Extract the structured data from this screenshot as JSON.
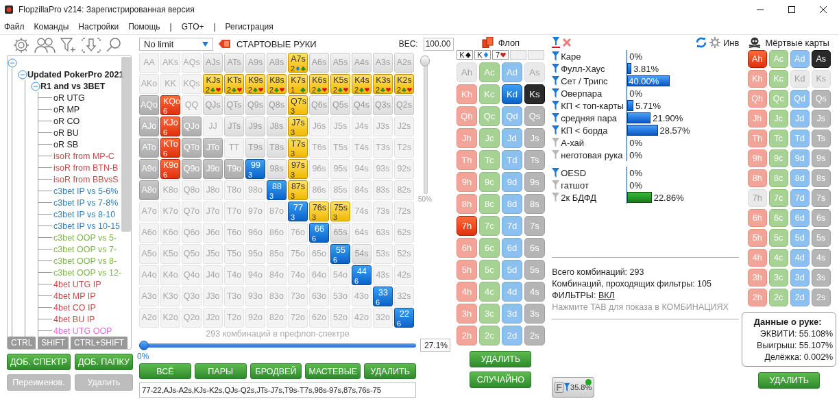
{
  "window": {
    "title": "FlopzillaPro v214: Зарегистрированная версия"
  },
  "menu": [
    "Файл",
    "Команды",
    "Настройки",
    "Помощь",
    "|",
    "GTO+",
    "|",
    "Регистрация"
  ],
  "tree": {
    "expanded": true,
    "children": [
      {
        "label": "Updated PokerPro 2021",
        "expanded": true,
        "children": [
          {
            "label": "R1 and vs 3BET",
            "expanded": true,
            "children": [
              {
                "label": "oR UTG",
                "color": "#1a1a1a"
              },
              {
                "label": "oR MP",
                "color": "#1a1a1a"
              },
              {
                "label": "oR CO",
                "color": "#1a1a1a"
              },
              {
                "label": "oR BU",
                "color": "#1a1a1a"
              },
              {
                "label": "oR SB",
                "color": "#1a1a1a"
              },
              {
                "label": "isoR from MP-C",
                "color": "#c94a4a"
              },
              {
                "label": "isoR from BTN-B",
                "color": "#c94a4a"
              },
              {
                "label": "isoR from BBvsS",
                "color": "#c94a4a"
              },
              {
                "label": "c3bet IP vs 5-6%",
                "color": "#2f7fb8"
              },
              {
                "label": "c3bet IP vs 7-8%",
                "color": "#2f7fb8"
              },
              {
                "label": "c3bet IP vs 8-10",
                "color": "#2f7fb8"
              },
              {
                "label": "c3bet IP vs 10-15",
                "color": "#2f7fb8"
              },
              {
                "label": "c3bet OOP vs 5-",
                "color": "#7ab648"
              },
              {
                "label": "c3bet OOP vs 7-",
                "color": "#7ab648"
              },
              {
                "label": "c3bet OOP vs 8-",
                "color": "#7ab648"
              },
              {
                "label": "c3bet OOP vs 12-",
                "color": "#7ab648"
              },
              {
                "label": "4bet UTG IP",
                "color": "#c94a4a"
              },
              {
                "label": "4bet MP IP",
                "color": "#c94a4a"
              },
              {
                "label": "4bet CO IP",
                "color": "#c94a4a"
              },
              {
                "label": "4bet BU IP",
                "color": "#c94a4a"
              },
              {
                "label": "4bet UTG OOP",
                "color": "#e070e0"
              }
            ]
          }
        ]
      }
    ]
  },
  "modifier_keys": [
    "CTRL",
    "SHIFT",
    "CTRL+SHIFT"
  ],
  "range_buttons": [
    {
      "label": "ДОБ. СПЕКТР",
      "disabled": false
    },
    {
      "label": "ДОБ. ПАПКУ",
      "disabled": false
    },
    {
      "label": "Переименов.",
      "disabled": true
    },
    {
      "label": "Удалить",
      "disabled": true
    }
  ],
  "grid_header": {
    "game": "No limit",
    "title": "СТАРТОВЫЕ РУКИ",
    "weight_label": "ВЕС:",
    "weight_value": "100.00"
  },
  "hand_grid": [
    [
      {
        "hand": "AA",
        "kind": "faded"
      },
      {
        "hand": "AKs",
        "kind": "faded"
      },
      {
        "hand": "AQs",
        "kind": "faded"
      },
      {
        "hand": "AJs",
        "kind": "normal"
      },
      {
        "hand": "ATs",
        "kind": "normal"
      },
      {
        "hand": "A9s",
        "kind": "normal"
      },
      {
        "hand": "A8s",
        "kind": "normal"
      },
      {
        "hand": "A7s",
        "kind": "yellow",
        "count": "2",
        "suits": [
          {
            "kind": "diamond"
          },
          {
            "kind": "club"
          }
        ]
      },
      {
        "hand": "A6s",
        "kind": "normal"
      },
      {
        "hand": "A5s",
        "kind": "normal"
      },
      {
        "hand": "A4s",
        "kind": "normal"
      },
      {
        "hand": "A3s",
        "kind": "normal"
      },
      {
        "hand": "A2s",
        "kind": "normal"
      }
    ],
    [
      {
        "hand": "AKo",
        "kind": "faded"
      },
      {
        "hand": "KK",
        "kind": "faded"
      },
      {
        "hand": "KQs",
        "kind": "faded"
      },
      {
        "hand": "KJs",
        "kind": "yellow",
        "count": "2",
        "suits": [
          {
            "kind": "club"
          },
          {
            "kind": "heart"
          }
        ]
      },
      {
        "hand": "KTs",
        "kind": "yellow",
        "count": "2",
        "suits": [
          {
            "kind": "club"
          },
          {
            "kind": "heart"
          }
        ]
      },
      {
        "hand": "K9s",
        "kind": "yellow",
        "count": "2",
        "suits": [
          {
            "kind": "club"
          },
          {
            "kind": "heart"
          }
        ]
      },
      {
        "hand": "K8s",
        "kind": "yellow",
        "count": "2",
        "suits": [
          {
            "kind": "club"
          },
          {
            "kind": "heart"
          }
        ]
      },
      {
        "hand": "K7s",
        "kind": "yellow",
        "count": "1",
        "suits": [
          {
            "kind": "club"
          }
        ]
      },
      {
        "hand": "K6s",
        "kind": "yellow",
        "count": "2",
        "suits": [
          {
            "kind": "club"
          },
          {
            "kind": "heart"
          }
        ]
      },
      {
        "hand": "K5s",
        "kind": "yellow",
        "count": "2",
        "suits": [
          {
            "kind": "club"
          },
          {
            "kind": "heart"
          }
        ]
      },
      {
        "hand": "K4s",
        "kind": "yellow",
        "count": "2",
        "suits": [
          {
            "kind": "club"
          },
          {
            "kind": "heart"
          }
        ]
      },
      {
        "hand": "K3s",
        "kind": "yellow",
        "count": "2",
        "suits": [
          {
            "kind": "club"
          },
          {
            "kind": "heart"
          }
        ]
      },
      {
        "hand": "K2s",
        "kind": "yellow",
        "count": "2",
        "suits": [
          {
            "kind": "club"
          },
          {
            "kind": "heart"
          }
        ]
      }
    ],
    [
      {
        "hand": "AQo",
        "kind": "grey"
      },
      {
        "hand": "KQo",
        "kind": "red",
        "count": "6"
      },
      {
        "hand": "QQ",
        "kind": "faded"
      },
      {
        "hand": "QJs",
        "kind": "normal"
      },
      {
        "hand": "QTs",
        "kind": "normal"
      },
      {
        "hand": "Q9s",
        "kind": "normal"
      },
      {
        "hand": "Q8s",
        "kind": "normal"
      },
      {
        "hand": "Q7s",
        "kind": "yellow",
        "count": "3"
      },
      {
        "hand": "Q6s",
        "kind": "normal"
      },
      {
        "hand": "Q5s",
        "kind": "normal"
      },
      {
        "hand": "Q4s",
        "kind": "normal"
      },
      {
        "hand": "Q3s",
        "kind": "normal"
      },
      {
        "hand": "Q2s",
        "kind": "normal"
      }
    ],
    [
      {
        "hand": "AJo",
        "kind": "grey"
      },
      {
        "hand": "KJo",
        "kind": "red",
        "count": "6"
      },
      {
        "hand": "QJo",
        "kind": "grey"
      },
      {
        "hand": "JJ",
        "kind": "faded"
      },
      {
        "hand": "JTs",
        "kind": "normal"
      },
      {
        "hand": "J9s",
        "kind": "normal"
      },
      {
        "hand": "J8s",
        "kind": "normal"
      },
      {
        "hand": "J7s",
        "kind": "yellow",
        "count": "3"
      },
      {
        "hand": "J6s",
        "kind": "faded"
      },
      {
        "hand": "J5s",
        "kind": "faded"
      },
      {
        "hand": "J4s",
        "kind": "faded"
      },
      {
        "hand": "J3s",
        "kind": "faded"
      },
      {
        "hand": "J2s",
        "kind": "faded"
      }
    ],
    [
      {
        "hand": "ATo",
        "kind": "grey"
      },
      {
        "hand": "KTo",
        "kind": "red",
        "count": "6"
      },
      {
        "hand": "QTo",
        "kind": "grey"
      },
      {
        "hand": "JTo",
        "kind": "grey"
      },
      {
        "hand": "TT",
        "kind": "faded"
      },
      {
        "hand": "T9s",
        "kind": "normal"
      },
      {
        "hand": "T8s",
        "kind": "normal"
      },
      {
        "hand": "T7s",
        "kind": "yellow",
        "count": "3"
      },
      {
        "hand": "T6s",
        "kind": "faded"
      },
      {
        "hand": "T5s",
        "kind": "faded"
      },
      {
        "hand": "T4s",
        "kind": "faded"
      },
      {
        "hand": "T3s",
        "kind": "faded"
      },
      {
        "hand": "T2s",
        "kind": "faded"
      }
    ],
    [
      {
        "hand": "A9o",
        "kind": "grey"
      },
      {
        "hand": "K9o",
        "kind": "red",
        "count": "6"
      },
      {
        "hand": "Q9o",
        "kind": "grey"
      },
      {
        "hand": "J9o",
        "kind": "grey"
      },
      {
        "hand": "T9o",
        "kind": "grey"
      },
      {
        "hand": "99",
        "kind": "blue",
        "count": "3"
      },
      {
        "hand": "98s",
        "kind": "normal"
      },
      {
        "hand": "97s",
        "kind": "yellow",
        "count": "3"
      },
      {
        "hand": "96s",
        "kind": "faded"
      },
      {
        "hand": "95s",
        "kind": "faded"
      },
      {
        "hand": "94s",
        "kind": "faded"
      },
      {
        "hand": "93s",
        "kind": "faded"
      },
      {
        "hand": "92s",
        "kind": "faded"
      }
    ],
    [
      {
        "hand": "A8o",
        "kind": "grey"
      },
      {
        "hand": "K8o",
        "kind": "faded"
      },
      {
        "hand": "Q8o",
        "kind": "faded"
      },
      {
        "hand": "J8o",
        "kind": "faded"
      },
      {
        "hand": "T8o",
        "kind": "faded"
      },
      {
        "hand": "98o",
        "kind": "faded"
      },
      {
        "hand": "88",
        "kind": "blue",
        "count": "3"
      },
      {
        "hand": "87s",
        "kind": "yellow",
        "count": "3"
      },
      {
        "hand": "86s",
        "kind": "faded"
      },
      {
        "hand": "85s",
        "kind": "faded"
      },
      {
        "hand": "84s",
        "kind": "faded"
      },
      {
        "hand": "83s",
        "kind": "faded"
      },
      {
        "hand": "82s",
        "kind": "faded"
      }
    ],
    [
      {
        "hand": "A7o",
        "kind": "faded"
      },
      {
        "hand": "K7o",
        "kind": "faded"
      },
      {
        "hand": "Q7o",
        "kind": "faded"
      },
      {
        "hand": "J7o",
        "kind": "faded"
      },
      {
        "hand": "T7o",
        "kind": "faded"
      },
      {
        "hand": "97o",
        "kind": "faded"
      },
      {
        "hand": "87o",
        "kind": "faded"
      },
      {
        "hand": "77",
        "kind": "blue",
        "count": "3"
      },
      {
        "hand": "76s",
        "kind": "yellow",
        "count": "3"
      },
      {
        "hand": "75s",
        "kind": "yellow",
        "count": "3"
      },
      {
        "hand": "74s",
        "kind": "faded"
      },
      {
        "hand": "73s",
        "kind": "faded"
      },
      {
        "hand": "72s",
        "kind": "faded"
      }
    ],
    [
      {
        "hand": "A6o",
        "kind": "faded"
      },
      {
        "hand": "K6o",
        "kind": "faded"
      },
      {
        "hand": "Q6o",
        "kind": "faded"
      },
      {
        "hand": "J6o",
        "kind": "faded"
      },
      {
        "hand": "T6o",
        "kind": "faded"
      },
      {
        "hand": "96o",
        "kind": "faded"
      },
      {
        "hand": "86o",
        "kind": "faded"
      },
      {
        "hand": "76o",
        "kind": "faded"
      },
      {
        "hand": "66",
        "kind": "blue",
        "count": "6"
      },
      {
        "hand": "65s",
        "kind": "normal"
      },
      {
        "hand": "64s",
        "kind": "faded"
      },
      {
        "hand": "63s",
        "kind": "faded"
      },
      {
        "hand": "62s",
        "kind": "faded"
      }
    ],
    [
      {
        "hand": "A5o",
        "kind": "faded"
      },
      {
        "hand": "K5o",
        "kind": "faded"
      },
      {
        "hand": "Q5o",
        "kind": "faded"
      },
      {
        "hand": "J5o",
        "kind": "faded"
      },
      {
        "hand": "T5o",
        "kind": "faded"
      },
      {
        "hand": "95o",
        "kind": "faded"
      },
      {
        "hand": "85o",
        "kind": "faded"
      },
      {
        "hand": "75o",
        "kind": "faded"
      },
      {
        "hand": "65o",
        "kind": "faded"
      },
      {
        "hand": "55",
        "kind": "blue",
        "count": "6"
      },
      {
        "hand": "54s",
        "kind": "normal"
      },
      {
        "hand": "53s",
        "kind": "faded"
      },
      {
        "hand": "52s",
        "kind": "faded"
      }
    ],
    [
      {
        "hand": "A4o",
        "kind": "faded"
      },
      {
        "hand": "K4o",
        "kind": "faded"
      },
      {
        "hand": "Q4o",
        "kind": "faded"
      },
      {
        "hand": "J4o",
        "kind": "faded"
      },
      {
        "hand": "T4o",
        "kind": "faded"
      },
      {
        "hand": "94o",
        "kind": "faded"
      },
      {
        "hand": "84o",
        "kind": "faded"
      },
      {
        "hand": "74o",
        "kind": "faded"
      },
      {
        "hand": "64o",
        "kind": "faded"
      },
      {
        "hand": "54o",
        "kind": "faded"
      },
      {
        "hand": "44",
        "kind": "blue",
        "count": "6"
      },
      {
        "hand": "43s",
        "kind": "faded"
      },
      {
        "hand": "42s",
        "kind": "faded"
      }
    ],
    [
      {
        "hand": "A3o",
        "kind": "faded"
      },
      {
        "hand": "K3o",
        "kind": "faded"
      },
      {
        "hand": "Q3o",
        "kind": "faded"
      },
      {
        "hand": "J3o",
        "kind": "faded"
      },
      {
        "hand": "T3o",
        "kind": "faded"
      },
      {
        "hand": "93o",
        "kind": "faded"
      },
      {
        "hand": "83o",
        "kind": "faded"
      },
      {
        "hand": "73o",
        "kind": "faded"
      },
      {
        "hand": "63o",
        "kind": "faded"
      },
      {
        "hand": "53o",
        "kind": "faded"
      },
      {
        "hand": "43o",
        "kind": "faded"
      },
      {
        "hand": "33",
        "kind": "blue",
        "count": "6"
      },
      {
        "hand": "32s",
        "kind": "faded"
      }
    ],
    [
      {
        "hand": "A2o",
        "kind": "faded"
      },
      {
        "hand": "K2o",
        "kind": "faded"
      },
      {
        "hand": "Q2o",
        "kind": "faded"
      },
      {
        "hand": "J2o",
        "kind": "faded"
      },
      {
        "hand": "T2o",
        "kind": "faded"
      },
      {
        "hand": "92o",
        "kind": "faded"
      },
      {
        "hand": "82o",
        "kind": "faded"
      },
      {
        "hand": "72o",
        "kind": "faded"
      },
      {
        "hand": "62o",
        "kind": "faded"
      },
      {
        "hand": "52o",
        "kind": "faded"
      },
      {
        "hand": "42o",
        "kind": "faded"
      },
      {
        "hand": "32o",
        "kind": "faded"
      },
      {
        "hand": "22",
        "kind": "blue",
        "count": "6"
      }
    ]
  ],
  "weight_slider": {
    "level": 1,
    "tick_label": "50%"
  },
  "range_info": {
    "caption": "293 комбинаций в префлоп-спектре",
    "level": 0,
    "min_label": "0%",
    "percent": "27.1%"
  },
  "grid_buttons": [
    "ВСЁ",
    "ПАРЫ",
    "БРОДВЕЙ",
    "МАСТЕВЫЕ",
    "УДАЛИТЬ"
  ],
  "range_text": "77-22,AJs-A2s,KJs-K2s,QJs-Q2s,JTs-J7s,T9s-T7s,98s-97s,87s,76s-75",
  "flop": {
    "title": "Флоп",
    "board": [
      {
        "kind": "card",
        "rank": "K",
        "suit": {
          "kind": "spade"
        }
      },
      {
        "kind": "card",
        "rank": "K",
        "suit": {
          "kind": "diamond"
        }
      },
      {
        "kind": "card",
        "rank": "7",
        "suit": {
          "kind": "heart"
        }
      },
      {
        "kind": "empty"
      },
      {
        "kind": "empty"
      }
    ],
    "deck": [
      [
        {
          "card": "Ah",
          "kind": "heart",
          "selected": false,
          "disabled": true
        },
        {
          "card": "Ac",
          "kind": "club",
          "selected": false,
          "disabled": false
        },
        {
          "card": "Ad",
          "kind": "diamond",
          "selected": false,
          "disabled": false
        },
        {
          "card": "As",
          "kind": "spade",
          "selected": false,
          "disabled": true
        }
      ],
      [
        {
          "card": "Kh",
          "kind": "heart",
          "selected": false,
          "disabled": false
        },
        {
          "card": "Kc",
          "kind": "club",
          "selected": false,
          "disabled": false
        },
        {
          "card": "Kd",
          "kind": "diamond",
          "selected": true,
          "disabled": false
        },
        {
          "card": "Ks",
          "kind": "spade",
          "selected": true,
          "disabled": false
        }
      ],
      [
        {
          "card": "Qh",
          "kind": "heart",
          "selected": false,
          "disabled": false
        },
        {
          "card": "Qc",
          "kind": "club",
          "selected": false,
          "disabled": false
        },
        {
          "card": "Qd",
          "kind": "diamond",
          "selected": false,
          "disabled": false
        },
        {
          "card": "Qs",
          "kind": "spade",
          "selected": false,
          "disabled": false
        }
      ],
      [
        {
          "card": "Jh",
          "kind": "heart",
          "selected": false,
          "disabled": false
        },
        {
          "card": "Jc",
          "kind": "club",
          "selected": false,
          "disabled": false
        },
        {
          "card": "Jd",
          "kind": "diamond",
          "selected": false,
          "disabled": false
        },
        {
          "card": "Js",
          "kind": "spade",
          "selected": false,
          "disabled": false
        }
      ],
      [
        {
          "card": "Th",
          "kind": "heart",
          "selected": false,
          "disabled": false
        },
        {
          "card": "Tc",
          "kind": "club",
          "selected": false,
          "disabled": false
        },
        {
          "card": "Td",
          "kind": "diamond",
          "selected": false,
          "disabled": false
        },
        {
          "card": "Ts",
          "kind": "spade",
          "selected": false,
          "disabled": false
        }
      ],
      [
        {
          "card": "9h",
          "kind": "heart",
          "selected": false,
          "disabled": false
        },
        {
          "card": "9c",
          "kind": "club",
          "selected": false,
          "disabled": false
        },
        {
          "card": "9d",
          "kind": "diamond",
          "selected": false,
          "disabled": false
        },
        {
          "card": "9s",
          "kind": "spade",
          "selected": false,
          "disabled": false
        }
      ],
      [
        {
          "card": "8h",
          "kind": "heart",
          "selected": false,
          "disabled": false
        },
        {
          "card": "8c",
          "kind": "club",
          "selected": false,
          "disabled": false
        },
        {
          "card": "8d",
          "kind": "diamond",
          "selected": false,
          "disabled": false
        },
        {
          "card": "8s",
          "kind": "spade",
          "selected": false,
          "disabled": false
        }
      ],
      [
        {
          "card": "7h",
          "kind": "heart",
          "selected": true,
          "disabled": false
        },
        {
          "card": "7c",
          "kind": "club",
          "selected": false,
          "disabled": false
        },
        {
          "card": "7d",
          "kind": "diamond",
          "selected": false,
          "disabled": false
        },
        {
          "card": "7s",
          "kind": "spade",
          "selected": false,
          "disabled": false
        }
      ],
      [
        {
          "card": "6h",
          "kind": "heart",
          "selected": false,
          "disabled": false
        },
        {
          "card": "6c",
          "kind": "club",
          "selected": false,
          "disabled": false
        },
        {
          "card": "6d",
          "kind": "diamond",
          "selected": false,
          "disabled": false
        },
        {
          "card": "6s",
          "kind": "spade",
          "selected": false,
          "disabled": false
        }
      ],
      [
        {
          "card": "5h",
          "kind": "heart",
          "selected": false,
          "disabled": false
        },
        {
          "card": "5c",
          "kind": "club",
          "selected": false,
          "disabled": false
        },
        {
          "card": "5d",
          "kind": "diamond",
          "selected": false,
          "disabled": false
        },
        {
          "card": "5s",
          "kind": "spade",
          "selected": false,
          "disabled": false
        }
      ],
      [
        {
          "card": "4h",
          "kind": "heart",
          "selected": false,
          "disabled": false
        },
        {
          "card": "4c",
          "kind": "club",
          "selected": false,
          "disabled": false
        },
        {
          "card": "4d",
          "kind": "diamond",
          "selected": false,
          "disabled": false
        },
        {
          "card": "4s",
          "kind": "spade",
          "selected": false,
          "disabled": false
        }
      ],
      [
        {
          "card": "3h",
          "kind": "heart",
          "selected": false,
          "disabled": false
        },
        {
          "card": "3c",
          "kind": "club",
          "selected": false,
          "disabled": false
        },
        {
          "card": "3d",
          "kind": "diamond",
          "selected": false,
          "disabled": false
        },
        {
          "card": "3s",
          "kind": "spade",
          "selected": false,
          "disabled": false
        }
      ],
      [
        {
          "card": "2h",
          "kind": "heart",
          "selected": false,
          "disabled": false
        },
        {
          "card": "2c",
          "kind": "club",
          "selected": false,
          "disabled": false
        },
        {
          "card": "2d",
          "kind": "diamond",
          "selected": false,
          "disabled": false
        },
        {
          "card": "2s",
          "kind": "spade",
          "selected": false,
          "disabled": false
        }
      ]
    ],
    "buttons": [
      "УДАЛИТЬ",
      "СЛУЧАЙНО"
    ]
  },
  "stats": {
    "invert_label": "Инв",
    "groups": [
      {
        "kind": "made",
        "rows": [
          {
            "label": "Каре",
            "active": true,
            "level": 0,
            "value": "0%",
            "selected": false
          },
          {
            "label": "Фулл-Хаус",
            "active": true,
            "level": 0.0381,
            "value": "3.81%",
            "selected": false
          },
          {
            "label": "Сет / Трипс",
            "active": true,
            "level": 0.4,
            "value": "40.00%",
            "selected": true
          },
          {
            "label": "Оверпара",
            "active": true,
            "level": 0,
            "value": "0%",
            "selected": false
          },
          {
            "label": "КП < топ-карты",
            "active": true,
            "level": 0.0571,
            "value": "5.71%",
            "selected": false
          },
          {
            "label": "средняя пара",
            "active": true,
            "level": 0.219,
            "value": "21.90%",
            "selected": false
          },
          {
            "label": "КП < борда",
            "active": true,
            "level": 0.2857,
            "value": "28.57%",
            "selected": false
          },
          {
            "label": "А-хай",
            "active": false,
            "level": 0,
            "value": "0%",
            "selected": false
          },
          {
            "label": "неготовая рука",
            "active": false,
            "level": 0,
            "value": "0%",
            "selected": false
          }
        ]
      },
      {
        "kind": "draw",
        "rows": [
          {
            "label": "OESD",
            "active": true,
            "level": 0,
            "value": "0%",
            "selected": false
          },
          {
            "label": "гатшот",
            "active": false,
            "level": 0,
            "value": "0%",
            "selected": false
          },
          {
            "label": "2к БДФД",
            "active": false,
            "level": 0.2286,
            "value": "22.86%",
            "selected": false
          }
        ]
      }
    ],
    "total": "Всего комбинаций: 293",
    "passing": "Комбинаций, проходящих фильтры: 105",
    "filters": {
      "label": "ФИЛЬТРЫ:",
      "link": "ВКЛ"
    },
    "hint": "Нажмите TAB для показа в КОМБИНАЦИЯХ",
    "filter_button": {
      "letter": "F",
      "value": "35.8%",
      "active": true
    }
  },
  "dead_cards": {
    "title": "Мёртвые карты",
    "deck": [
      [
        {
          "card": "Ah",
          "kind": "heart",
          "selected": true,
          "disabled": false
        },
        {
          "card": "Ac",
          "kind": "club",
          "selected": false,
          "disabled": false
        },
        {
          "card": "Ad",
          "kind": "diamond",
          "selected": false,
          "disabled": false
        },
        {
          "card": "As",
          "kind": "spade",
          "selected": true,
          "disabled": false
        }
      ],
      [
        {
          "card": "Kh",
          "kind": "heart",
          "selected": false,
          "disabled": false
        },
        {
          "card": "Kc",
          "kind": "club",
          "selected": false,
          "disabled": false
        },
        {
          "card": "Kd",
          "kind": "diamond",
          "selected": false,
          "disabled": true
        },
        {
          "card": "Ks",
          "kind": "spade",
          "selected": false,
          "disabled": true
        }
      ],
      [
        {
          "card": "Qh",
          "kind": "heart",
          "selected": false,
          "disabled": false
        },
        {
          "card": "Qc",
          "kind": "club",
          "selected": false,
          "disabled": false
        },
        {
          "card": "Qd",
          "kind": "diamond",
          "selected": false,
          "disabled": false
        },
        {
          "card": "Qs",
          "kind": "spade",
          "selected": false,
          "disabled": false
        }
      ],
      [
        {
          "card": "Jh",
          "kind": "heart",
          "selected": false,
          "disabled": false
        },
        {
          "card": "Jc",
          "kind": "club",
          "selected": false,
          "disabled": false
        },
        {
          "card": "Jd",
          "kind": "diamond",
          "selected": false,
          "disabled": false
        },
        {
          "card": "Js",
          "kind": "spade",
          "selected": false,
          "disabled": false
        }
      ],
      [
        {
          "card": "Th",
          "kind": "heart",
          "selected": false,
          "disabled": false
        },
        {
          "card": "Tc",
          "kind": "club",
          "selected": false,
          "disabled": false
        },
        {
          "card": "Td",
          "kind": "diamond",
          "selected": false,
          "disabled": false
        },
        {
          "card": "Ts",
          "kind": "spade",
          "selected": false,
          "disabled": false
        }
      ],
      [
        {
          "card": "9h",
          "kind": "heart",
          "selected": false,
          "disabled": false
        },
        {
          "card": "9c",
          "kind": "club",
          "selected": false,
          "disabled": false
        },
        {
          "card": "9d",
          "kind": "diamond",
          "selected": false,
          "disabled": false
        },
        {
          "card": "9s",
          "kind": "spade",
          "selected": false,
          "disabled": false
        }
      ],
      [
        {
          "card": "8h",
          "kind": "heart",
          "selected": false,
          "disabled": false
        },
        {
          "card": "8c",
          "kind": "club",
          "selected": false,
          "disabled": false
        },
        {
          "card": "8d",
          "kind": "diamond",
          "selected": false,
          "disabled": false
        },
        {
          "card": "8s",
          "kind": "spade",
          "selected": false,
          "disabled": false
        }
      ],
      [
        {
          "card": "7h",
          "kind": "heart",
          "selected": false,
          "disabled": true
        },
        {
          "card": "7c",
          "kind": "club",
          "selected": false,
          "disabled": false
        },
        {
          "card": "7d",
          "kind": "diamond",
          "selected": false,
          "disabled": false
        },
        {
          "card": "7s",
          "kind": "spade",
          "selected": false,
          "disabled": false
        }
      ],
      [
        {
          "card": "6h",
          "kind": "heart",
          "selected": false,
          "disabled": false
        },
        {
          "card": "6c",
          "kind": "club",
          "selected": false,
          "disabled": false
        },
        {
          "card": "6d",
          "kind": "diamond",
          "selected": false,
          "disabled": false
        },
        {
          "card": "6s",
          "kind": "spade",
          "selected": false,
          "disabled": false
        }
      ],
      [
        {
          "card": "5h",
          "kind": "heart",
          "selected": false,
          "disabled": false
        },
        {
          "card": "5c",
          "kind": "club",
          "selected": false,
          "disabled": false
        },
        {
          "card": "5d",
          "kind": "diamond",
          "selected": false,
          "disabled": false
        },
        {
          "card": "5s",
          "kind": "spade",
          "selected": false,
          "disabled": false
        }
      ],
      [
        {
          "card": "4h",
          "kind": "heart",
          "selected": false,
          "disabled": false
        },
        {
          "card": "4c",
          "kind": "club",
          "selected": false,
          "disabled": false
        },
        {
          "card": "4d",
          "kind": "diamond",
          "selected": false,
          "disabled": false
        },
        {
          "card": "4s",
          "kind": "spade",
          "selected": false,
          "disabled": false
        }
      ],
      [
        {
          "card": "3h",
          "kind": "heart",
          "selected": false,
          "disabled": false
        },
        {
          "card": "3c",
          "kind": "club",
          "selected": false,
          "disabled": false
        },
        {
          "card": "3d",
          "kind": "diamond",
          "selected": false,
          "disabled": false
        },
        {
          "card": "3s",
          "kind": "spade",
          "selected": false,
          "disabled": false
        }
      ],
      [
        {
          "card": "2h",
          "kind": "heart",
          "selected": false,
          "disabled": false
        },
        {
          "card": "2c",
          "kind": "club",
          "selected": false,
          "disabled": false
        },
        {
          "card": "2d",
          "kind": "diamond",
          "selected": false,
          "disabled": false
        },
        {
          "card": "2s",
          "kind": "spade",
          "selected": false,
          "disabled": false
        }
      ]
    ]
  },
  "hand_data": {
    "title": "Данные о руке:",
    "lines": [
      "ЭКВИТИ: 55.108%",
      "Выигрыш: 55.107%",
      "Делёжка: 0.002%"
    ],
    "button": "УДАЛИТЬ"
  }
}
